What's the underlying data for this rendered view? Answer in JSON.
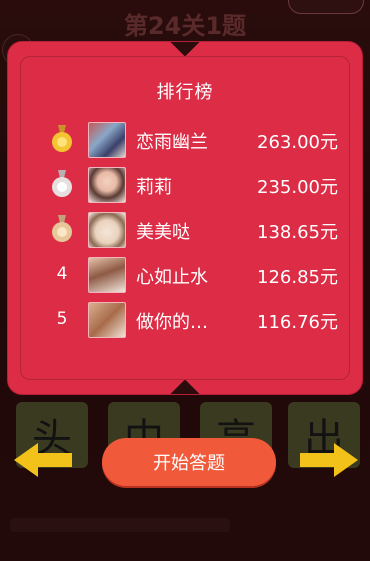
{
  "header": {
    "level_title": "第24关1题"
  },
  "leaderboard": {
    "title": "排行榜",
    "entries": [
      {
        "rank": "1",
        "name": "恋雨幽兰",
        "amount": "263.00元",
        "medal": "gold-medal-icon"
      },
      {
        "rank": "2",
        "name": "莉莉",
        "amount": "235.00元",
        "medal": "silver-medal-icon"
      },
      {
        "rank": "3",
        "name": "美美哒",
        "amount": "138.65元",
        "medal": "bronze-medal-icon"
      },
      {
        "rank": "4",
        "name": "心如止水",
        "amount": "126.85元"
      },
      {
        "rank": "5",
        "name": "做你的…",
        "amount": "116.76元"
      }
    ]
  },
  "tiles": [
    "头",
    "中",
    "高",
    "出"
  ],
  "start_button": {
    "label": "开始答题"
  },
  "colors": {
    "modal": "#dc2c46",
    "button": "#f05a3a",
    "arrow": "#f2c21a",
    "gold_medal": "#f4c531",
    "silver_medal": "#e6dfdf",
    "bronze_medal": "#e7c79a"
  }
}
